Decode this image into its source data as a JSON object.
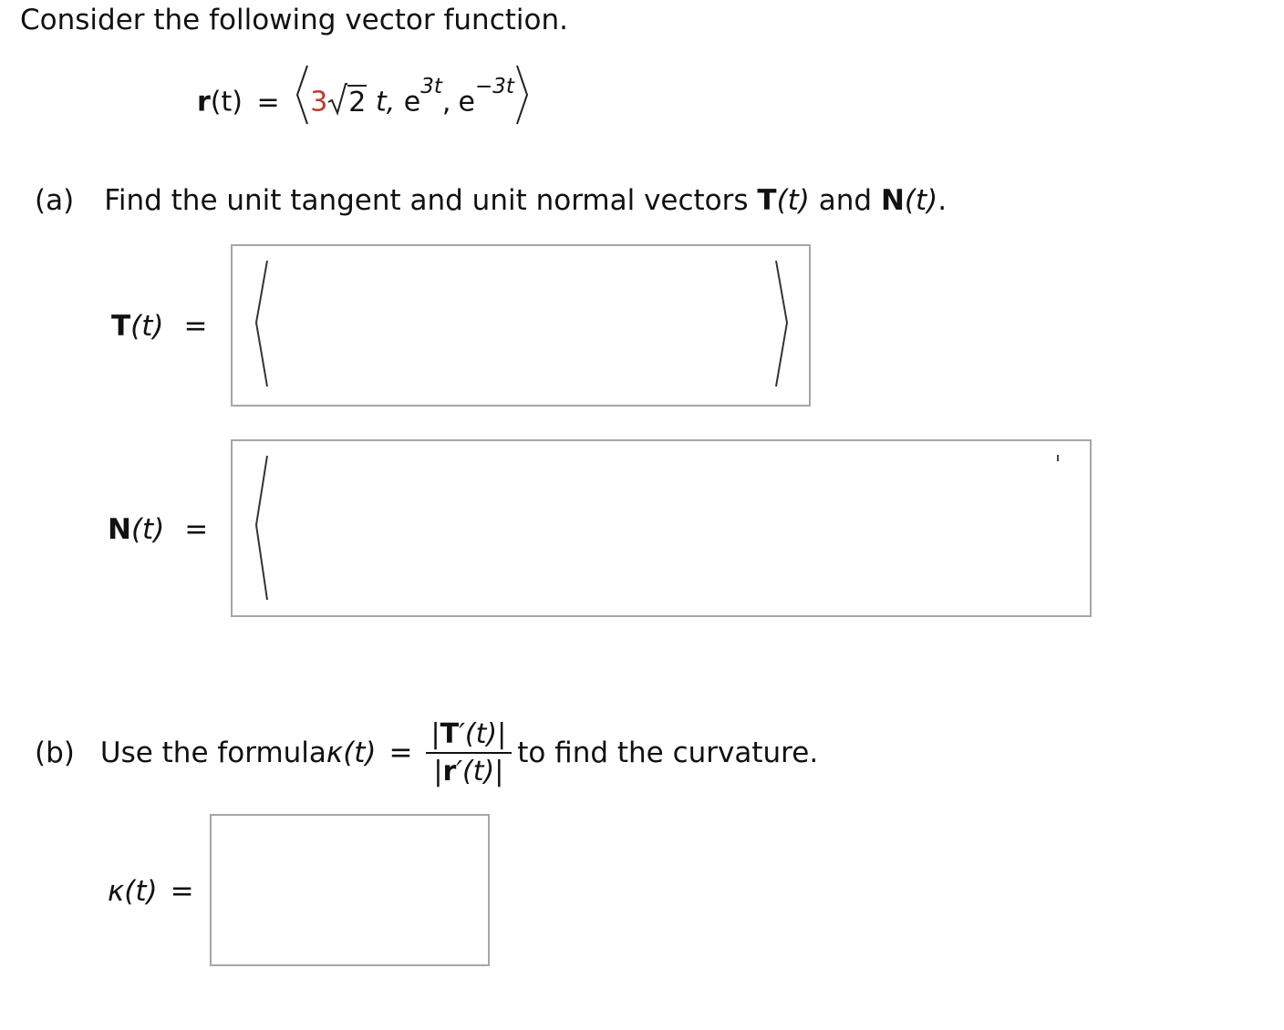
{
  "intro": "Consider the following vector function.",
  "function": {
    "name": "r",
    "arg": "(t)",
    "eq": "=",
    "coef": "3",
    "radicand": "2",
    "comp1_var": "t,",
    "comp2_base": "e",
    "comp2_exp": "3t",
    "comp3_base": "e",
    "comp3_exp": "−3t",
    "comma": ","
  },
  "part_a": {
    "label": "(a)",
    "text_before": "Find the unit tangent and unit normal vectors ",
    "T": "T",
    "T_arg": "(t)",
    "and": " and ",
    "N": "N",
    "N_arg": "(t)",
    "end": ".",
    "T_label": "T",
    "T_label_arg": "(t)",
    "N_label": "N",
    "N_label_arg": "(t)",
    "eq": "="
  },
  "part_b": {
    "label": "(b)",
    "text_before": "Use the formula ",
    "kappa": "κ",
    "kappa_arg": "(t)",
    "eq": "=",
    "num_T": "T",
    "num_rest": "′(t)",
    "den_r": "r",
    "den_rest": "′(t)",
    "bar": "|",
    "text_after": " to find the curvature.",
    "answer_label": "κ",
    "answer_arg": "(t)"
  }
}
